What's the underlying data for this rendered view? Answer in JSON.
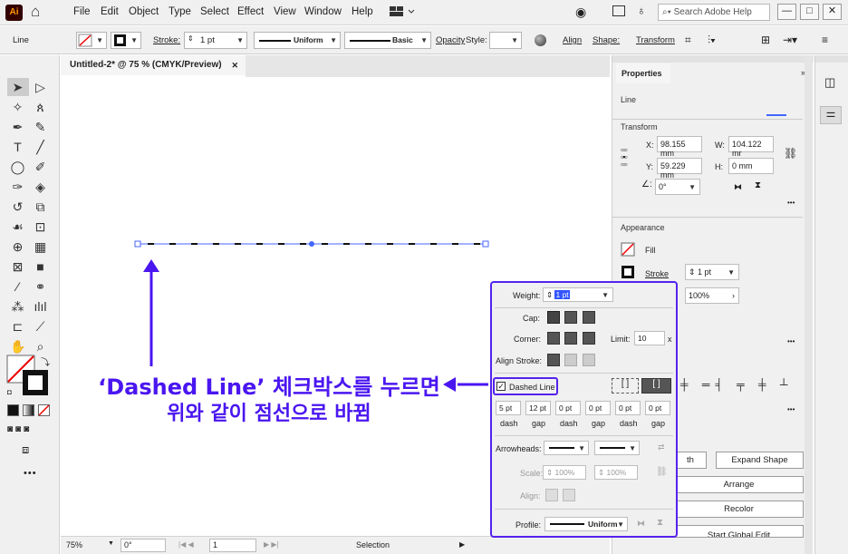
{
  "app": {
    "logo": "Ai",
    "home_icon": "home-icon"
  },
  "menu": [
    "File",
    "Edit",
    "Object",
    "Type",
    "Select",
    "Effect",
    "View",
    "Window",
    "Help"
  ],
  "search": {
    "placeholder": "Search Adobe Help"
  },
  "window_controls": {
    "minimize": "—",
    "maximize": "□",
    "close": "✕"
  },
  "control_bar": {
    "selection_type": "Line",
    "stroke_label": "Stroke:",
    "stroke_weight": "1 pt",
    "profile_uniform": "Uniform",
    "brush_basic": "Basic",
    "opacity_label": "Opacity",
    "style_label": "Style:",
    "align_label": "Align",
    "shape_label": "Shape:",
    "transform_label": "Transform"
  },
  "document": {
    "tab_title": "Untitled-2* @ 75 % (CMYK/Preview)",
    "tab_close": "✕"
  },
  "status": {
    "zoom": "75%",
    "rotation": "0°",
    "artboard": "1",
    "mode": "Selection"
  },
  "properties": {
    "tab": "Properties",
    "object_type": "Line",
    "transform_title": "Transform",
    "x_label": "X:",
    "x_value": "98.155 mm",
    "y_label": "Y:",
    "y_value": "59.229 mm",
    "w_label": "W:",
    "w_value": "104.122 mr",
    "h_label": "H:",
    "h_value": "0 mm",
    "angle_value": "0°",
    "appearance_title": "Appearance",
    "fill_label": "Fill",
    "stroke_label": "Stroke",
    "stroke_value": "1 pt",
    "opacity_value": "100%",
    "more": "•••",
    "quick_actions": {
      "expand_shape": "Expand Shape",
      "arrange": "Arrange",
      "recolor": "Recolor",
      "start_global_edit": "Start Global Edit",
      "partial_left": "th"
    }
  },
  "stroke_panel": {
    "weight_label": "Weight:",
    "weight_value": "1 pt",
    "cap_label": "Cap:",
    "corner_label": "Corner:",
    "limit_label": "Limit:",
    "limit_value": "10",
    "limit_unit": "x",
    "align_label": "Align Stroke:",
    "dashed_label": "Dashed Line",
    "dashes": [
      {
        "value": "5 pt",
        "label": "dash"
      },
      {
        "value": "12 pt",
        "label": "gap"
      },
      {
        "value": "0 pt",
        "label": "dash"
      },
      {
        "value": "0 pt",
        "label": "gap"
      },
      {
        "value": "0 pt",
        "label": "dash"
      },
      {
        "value": "0 pt",
        "label": "gap"
      }
    ],
    "arrowheads_label": "Arrowheads:",
    "scale_label": "Scale:",
    "scale_1": "100%",
    "scale_2": "100%",
    "align_arrow_label": "Align:",
    "profile_label": "Profile:",
    "profile_value": "Uniform"
  },
  "annotation": {
    "line1": "‘Dashed Line’ 체크박스를 누르면",
    "line2": "위와 같이 점선으로 바뀜"
  },
  "colors": {
    "accent": "#5522ee",
    "annotation": "#4a16f0",
    "selection": "#4466ff"
  }
}
